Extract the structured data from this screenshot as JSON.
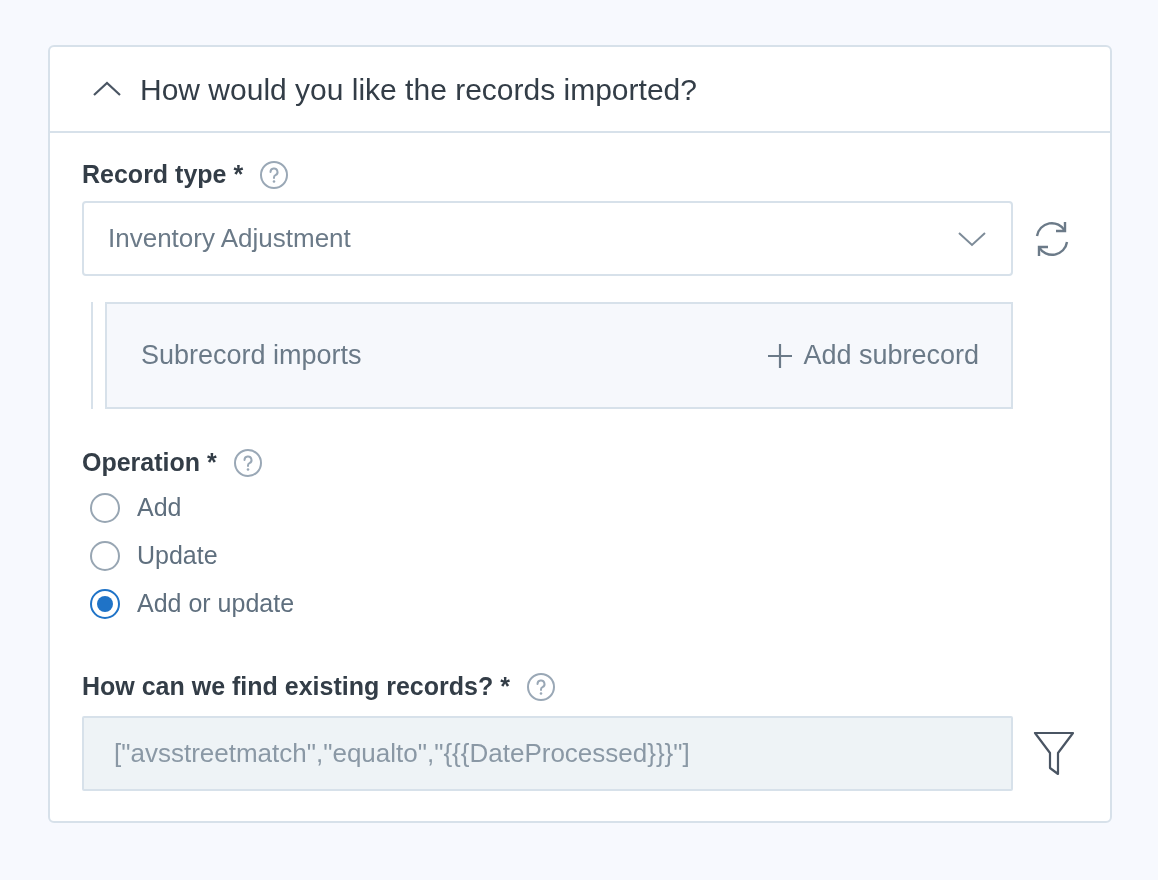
{
  "section": {
    "title": "How would you like the records imported?",
    "expanded": true
  },
  "record_type": {
    "label": "Record type *",
    "value": "Inventory Adjustment"
  },
  "subrecords": {
    "label": "Subrecord imports",
    "add_button": "Add subrecord"
  },
  "operation": {
    "label": "Operation *",
    "options": [
      {
        "label": "Add",
        "selected": false
      },
      {
        "label": "Update",
        "selected": false
      },
      {
        "label": "Add or update",
        "selected": true
      }
    ]
  },
  "lookup": {
    "label": "How can we find existing records? *",
    "value": "[\"avsstreetmatch\",\"equalto\",\"{{{DateProcessed}}}\"]",
    "disabled": true
  }
}
